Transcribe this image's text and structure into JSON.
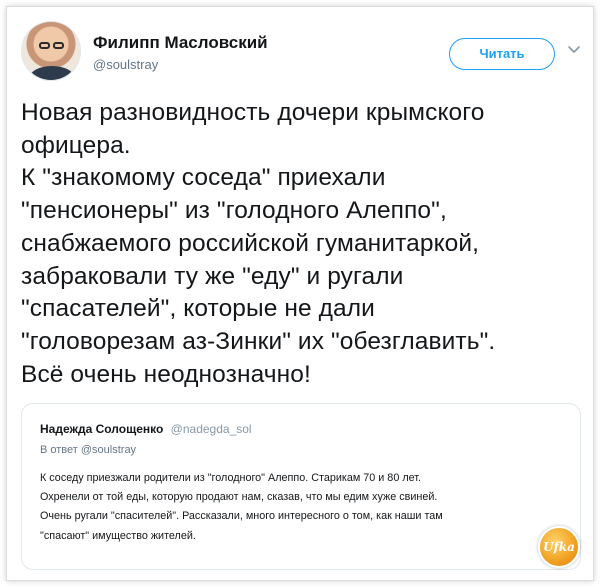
{
  "header": {
    "name": "Филипп Масловский",
    "handle": "@soulstray",
    "follow_label": "Читать"
  },
  "tweet": {
    "text": "Новая разновидность дочери крымского\nофицера.\nК \"знакомому соседа\" приехали\n\"пенсионеры\" из \"голодного Алеппо\",\nснабжаемого российской гуманитаркой,\nзабраковали ту же \"еду\" и ругали\n\"спасателей\", которые не дали\n\"головорезам аз-Зинки\" их \"обезглавить\".\nВсё очень неоднозначно!"
  },
  "quote": {
    "name": "Надежда Солощенко",
    "handle": "@nadegda_sol",
    "reply_to": "В ответ @soulstray",
    "text": "К соседу приезжали родители из \"голодного\" Алеппо. Старикам 70 и 80 лет.\nОхренели от той еды, которую продают нам, сказав, что мы едим хуже свиней.\nОчень ругали \"спасителей\". Рассказали, много интересного о том, как наши там\n\"спасают\" имущество жителей."
  },
  "watermark": {
    "text": "Ufka"
  },
  "colors": {
    "accent": "#1da1f2",
    "text": "#14171a",
    "muted": "#657786",
    "border": "#e1e8ed"
  },
  "icons": {
    "avatar": "user-photo",
    "menu": "chevron-down-icon"
  }
}
